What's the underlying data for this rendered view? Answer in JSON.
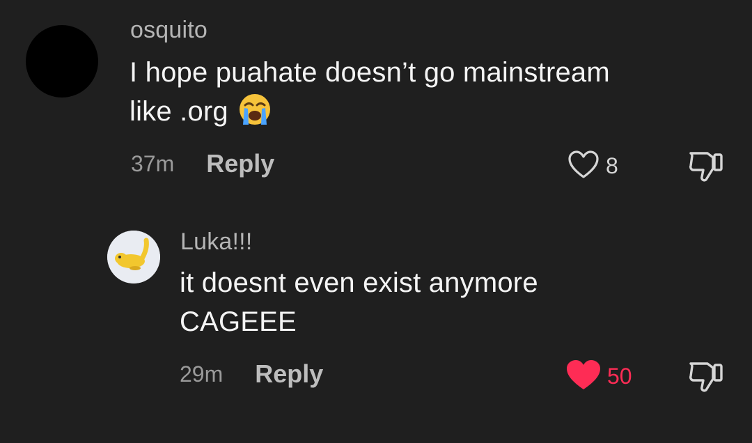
{
  "comments": [
    {
      "author": "osquito",
      "text_line1": "I hope puahate doesn’t go mainstream",
      "text_line2": "like .org",
      "emoji": "loudly-crying-face-emoji",
      "time": "37m",
      "reply_label": "Reply",
      "likes": "8",
      "liked": false
    },
    {
      "author": "Luka!!!",
      "text_line1": "it doesnt even exist anymore",
      "text_line2": "CAGEEE",
      "time": "29m",
      "reply_label": "Reply",
      "likes": "50",
      "liked": true
    }
  ],
  "colors": {
    "background": "#1f1f1f",
    "liked_red": "#fe2c55"
  }
}
